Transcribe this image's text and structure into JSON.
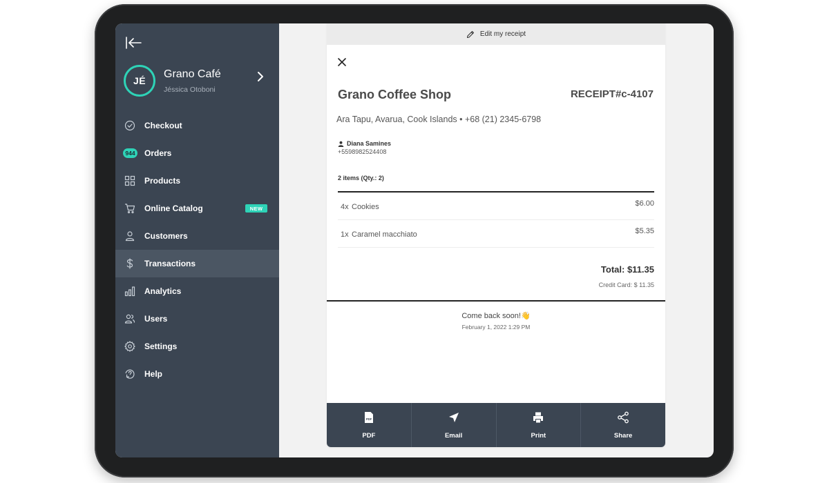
{
  "sidebar": {
    "profile": {
      "initials": "JÉ",
      "business": "Grano Café",
      "user": "Jéssica Otoboni"
    },
    "items": [
      {
        "label": "Checkout",
        "icon": "check-circle-icon"
      },
      {
        "label": "Orders",
        "icon": "orders-count-badge",
        "badge": "944"
      },
      {
        "label": "Products",
        "icon": "grid-icon"
      },
      {
        "label": "Online Catalog",
        "icon": "cart-icon",
        "badge": "NEW"
      },
      {
        "label": "Customers",
        "icon": "person-icon"
      },
      {
        "label": "Transactions",
        "icon": "dollar-icon",
        "active": true
      },
      {
        "label": "Analytics",
        "icon": "bar-chart-icon"
      },
      {
        "label": "Users",
        "icon": "users-icon"
      },
      {
        "label": "Settings",
        "icon": "gear-icon"
      },
      {
        "label": "Help",
        "icon": "help-icon"
      }
    ]
  },
  "receipt": {
    "edit_label": "Edit my receipt",
    "shop_name": "Grano Coffee Shop",
    "receipt_id": "RECEIPT#c-4107",
    "address": "Ara Tapu, Avarua, Cook Islands • +68 (21) 2345-6798",
    "customer": {
      "name": "Diana Samines",
      "phone": "+5598982524408"
    },
    "items_summary": "2 items (Qty.: 2)",
    "line_items": [
      {
        "qty": "4x",
        "name": "Cookies",
        "price": "$6.00"
      },
      {
        "qty": "1x",
        "name": "Caramel macchiato",
        "price": "$5.35"
      }
    ],
    "total": "Total: $11.35",
    "payment": "Credit Card: $ 11.35",
    "thanks": "Come back soon!",
    "thanks_emoji": "👋",
    "date": "February 1, 2022 1:29 PM"
  },
  "actions": [
    {
      "label": "PDF",
      "icon": "pdf-icon"
    },
    {
      "label": "Email",
      "icon": "send-icon"
    },
    {
      "label": "Print",
      "icon": "printer-icon"
    },
    {
      "label": "Share",
      "icon": "share-icon"
    }
  ],
  "colors": {
    "sidebar_bg": "#3b4552",
    "sidebar_active": "#4b5663",
    "accent": "#2ed3b7",
    "screen_bg": "#f2f2f2",
    "device_bezel": "#1f2021"
  }
}
